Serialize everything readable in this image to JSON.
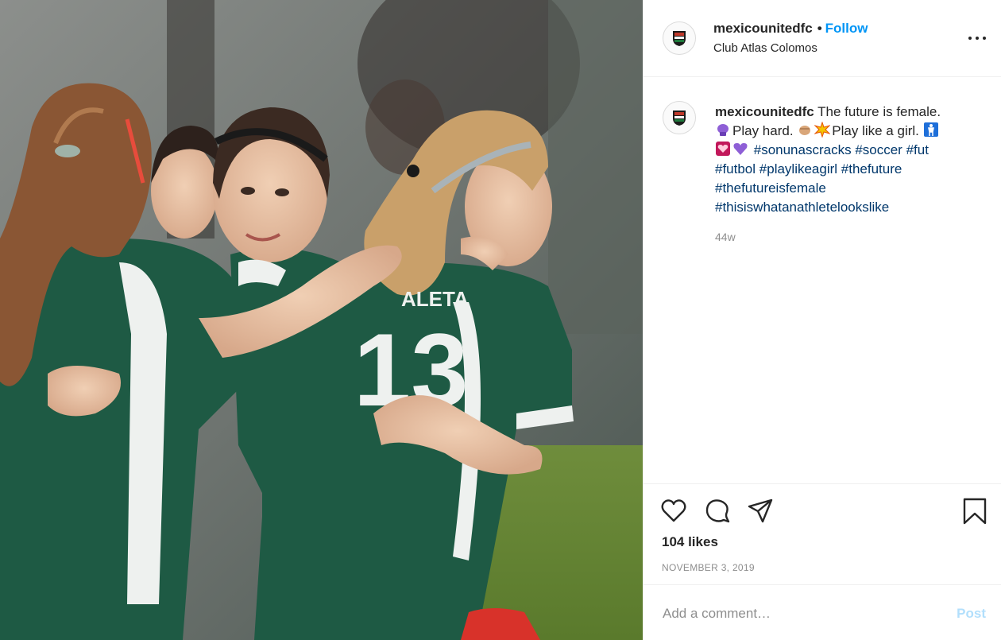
{
  "post": {
    "username": "mexicounitedfc",
    "follow_label": "Follow",
    "separator": "•",
    "location": "Club Atlas Colomos",
    "caption": {
      "intro": "The future is female.",
      "line2a": "Play hard.",
      "line2b": "Play like a girl.",
      "hashtags": [
        "#sonunascracks",
        "#soccer",
        "#fut",
        "#futbol",
        "#playlikeagirl",
        "#thefuture",
        "#thefutureisfemale",
        "#thisiswhatanathletelookslike"
      ]
    },
    "time_ago": "44w",
    "likes": "104 likes",
    "date": "NOVEMBER 3, 2019",
    "comment_placeholder": "Add a comment…",
    "post_label": "Post",
    "photo": {
      "jersey_name": "ALETA",
      "jersey_number": "13"
    }
  },
  "colors": {
    "accent": "#0095f6",
    "hashtag": "#00376b",
    "jersey": "#1e5a44",
    "post_disabled": "#b2dffc"
  },
  "icons": [
    "more-icon",
    "heart-icon",
    "comment-icon",
    "share-icon",
    "bookmark-icon",
    "crest-icon"
  ]
}
